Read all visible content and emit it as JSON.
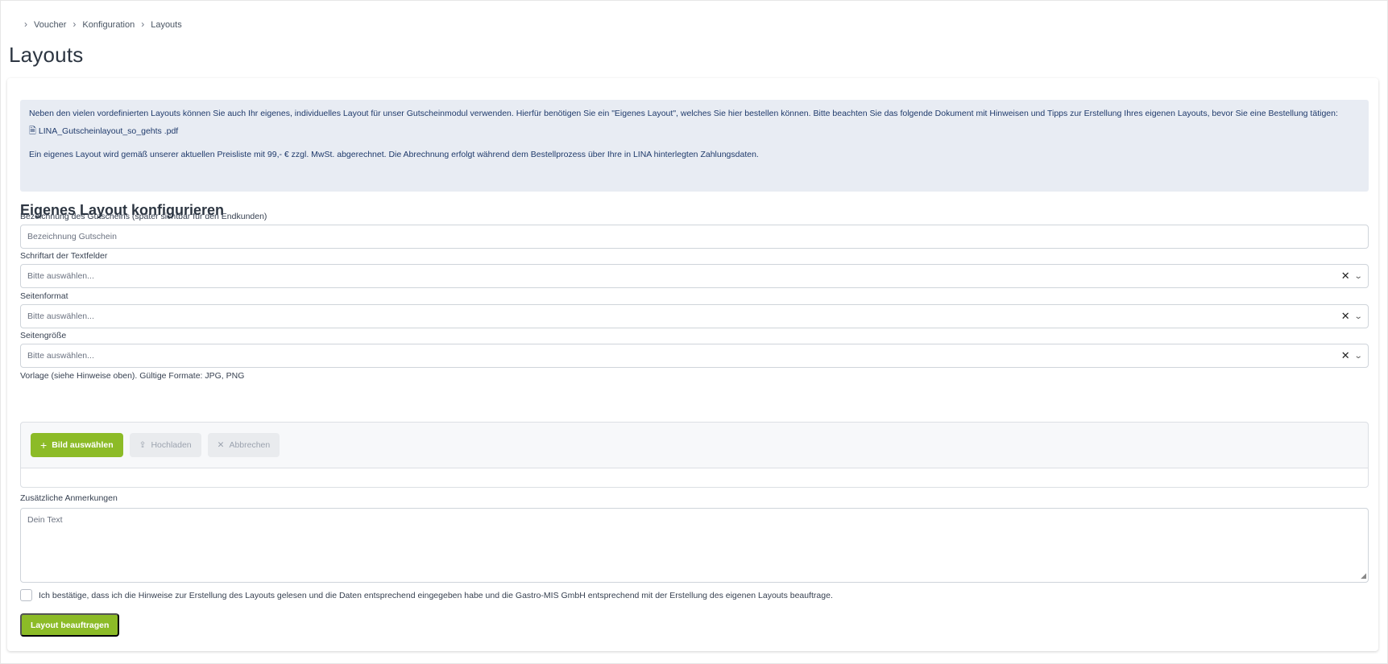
{
  "breadcrumb": [
    "Voucher",
    "Konfiguration",
    "Layouts"
  ],
  "page_title": "Layouts",
  "info": {
    "text": "Neben den vielen vordefinierten Layouts können Sie auch Ihr eigenes, individuelles Layout für unser Gutscheinmodul verwenden. Hierfür benötigen Sie ein \"Eigenes Layout\", welches Sie hier bestellen können. Bitte beachten Sie das folgende Dokument mit Hinweisen und Tipps zur Erstellung Ihres eigenen Layouts, bevor Sie eine Bestellung tätigen:",
    "pdf_name": "LINA_Gutscheinlayout_so_gehts .pdf",
    "pdf_icon": "file-pdf-icon",
    "price_note": "Ein eigenes Layout wird gemäß unserer aktuellen Preisliste mit 99,- € zzgl. MwSt. abgerechnet. Die Abrechnung erfolgt während dem Bestellprozess über Ihre in LINA hinterlegten Zahlungsdaten."
  },
  "section_title": "Eigenes Layout konfigurieren",
  "form": {
    "name_label": "Bezeichnung des Gutscheins (später sichtbar für den Endkunden)",
    "name_placeholder": "Bezeichnung Gutschein",
    "font_label": "Schriftart der Textfelder",
    "font_placeholder": "Bitte auswählen...",
    "format_label": "Seitenformat",
    "format_placeholder": "Bitte auswählen...",
    "size_label": "Seitengröße",
    "size_placeholder": "Bitte auswählen...",
    "template_label": "Vorlage (siehe Hinweise oben). Gültige Formate: JPG, PNG",
    "choose_image": "Bild auswählen",
    "upload": "Hochladen",
    "cancel": "Abbrechen",
    "notes_label": "Zusätzliche Anmerkungen",
    "notes_placeholder": "Dein Text",
    "confirm_text": "Ich bestätige, dass ich die Hinweise zur Erstellung des Layouts gelesen und die Daten entsprechend eingegeben habe und die Gastro-MIS GmbH entsprechend mit der Erstellung des eigenen Layouts beauftrage.",
    "submit": "Layout beauftragen"
  },
  "colors": {
    "accent": "#8cbb27",
    "info_bg": "#e8ecf3",
    "info_text": "#1f3a6b"
  }
}
